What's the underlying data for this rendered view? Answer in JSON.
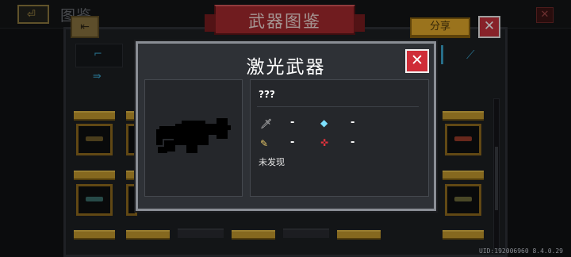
{
  "background": {
    "back_glyph": "⏎",
    "title": "图鉴",
    "close_glyph": "✕",
    "panel_back_glyph": "⇤",
    "share_label": "分享",
    "red_close_glyph": "✕",
    "tab_glyphs": [
      "⌐",
      "⇛"
    ]
  },
  "banner": {
    "title": "武器图鉴"
  },
  "modal": {
    "title": "激光武器",
    "close_glyph": "✕",
    "weapon_name": "???",
    "stats": [
      {
        "icon": "sword-icon",
        "glyph": "🗡",
        "color": "#d9d9d9",
        "value": "-"
      },
      {
        "icon": "crystal-icon",
        "glyph": "◆",
        "color": "#7de0ff",
        "value": "-"
      },
      {
        "icon": "bullet-icon",
        "glyph": "✎",
        "color": "#e8c86a",
        "value": "-"
      },
      {
        "icon": "crosshair-icon",
        "glyph": "✜",
        "color": "#e0323c",
        "value": "-"
      }
    ],
    "status": "未发现"
  },
  "footer": {
    "uid": "UID:192006960 8.4.0.29"
  },
  "colors": {
    "gold": "#c59a2e",
    "red": "#cf2d38",
    "panel": "#2e3136",
    "accent_blue": "#3aa1c9"
  }
}
